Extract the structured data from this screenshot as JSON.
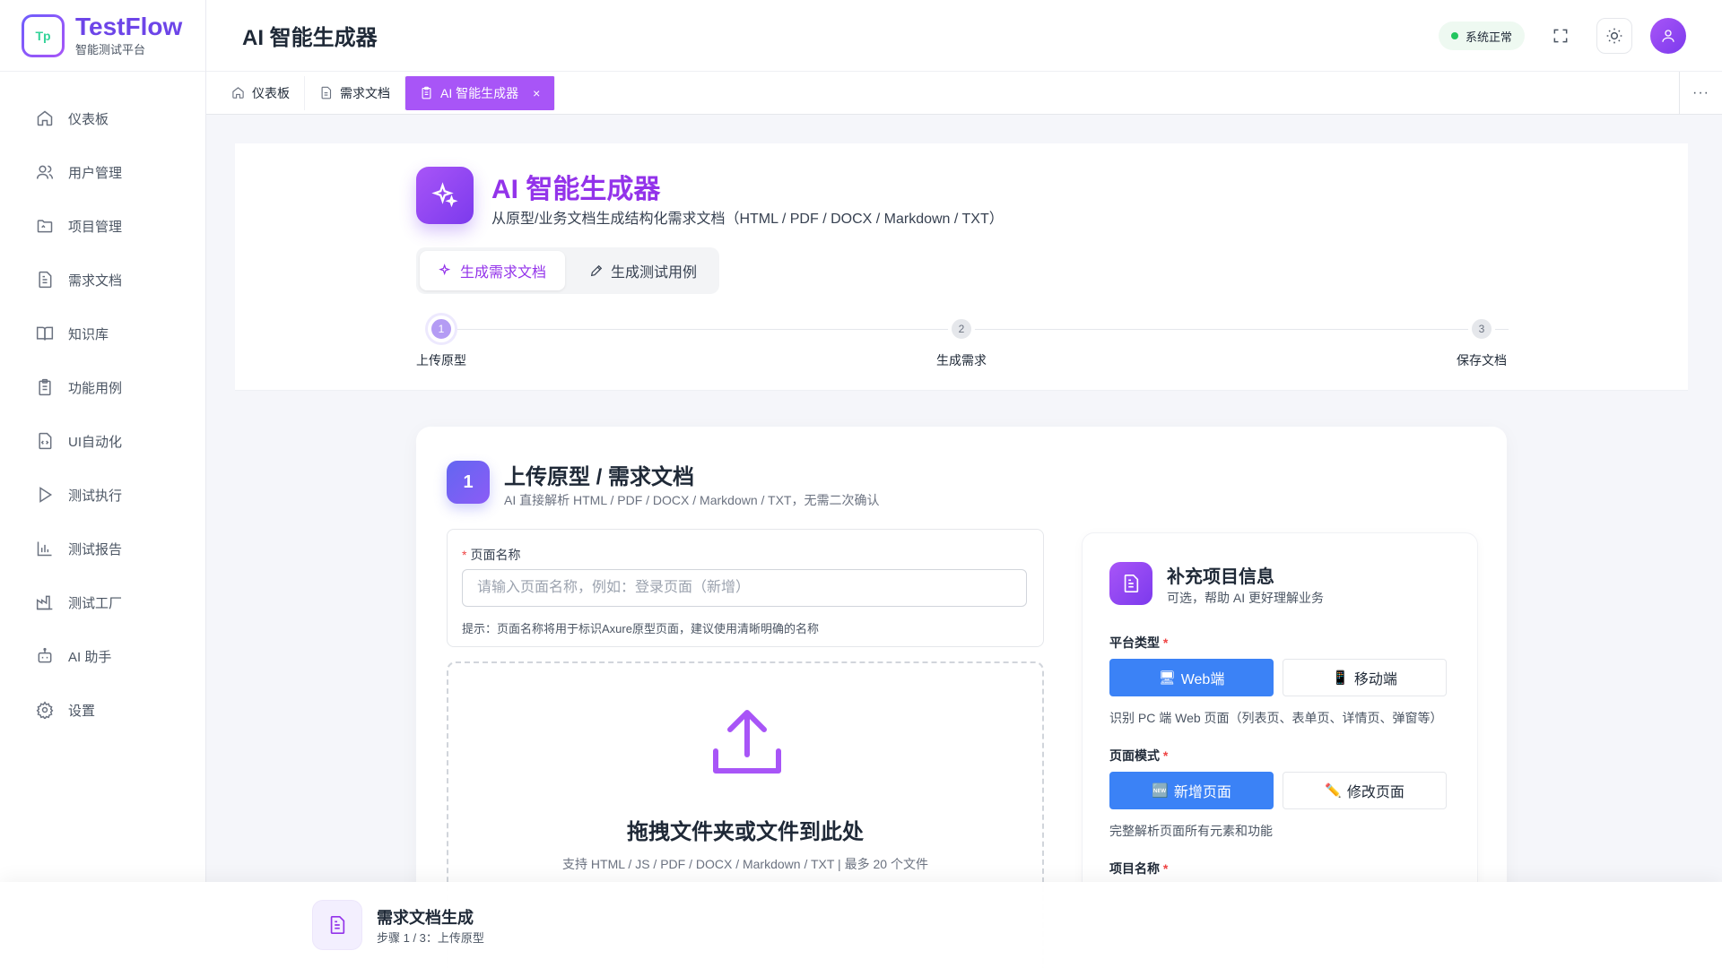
{
  "app": {
    "name": "TestFlow",
    "subtitle": "智能测试平台",
    "logo_mark": "Tp"
  },
  "sidebar": {
    "items": [
      {
        "label": "仪表板",
        "icon": "home-icon"
      },
      {
        "label": "用户管理",
        "icon": "users-icon"
      },
      {
        "label": "项目管理",
        "icon": "folder-icon"
      },
      {
        "label": "需求文档",
        "icon": "document-icon"
      },
      {
        "label": "知识库",
        "icon": "book-icon"
      },
      {
        "label": "功能用例",
        "icon": "clipboard-icon"
      },
      {
        "label": "UI自动化",
        "icon": "code-file-icon"
      },
      {
        "label": "测试执行",
        "icon": "play-icon"
      },
      {
        "label": "测试报告",
        "icon": "bar-chart-icon"
      },
      {
        "label": "测试工厂",
        "icon": "factory-icon"
      },
      {
        "label": "AI 助手",
        "icon": "robot-icon"
      },
      {
        "label": "设置",
        "icon": "gear-icon"
      }
    ]
  },
  "header": {
    "title": "AI 智能生成器",
    "status": "系统正常"
  },
  "tabs": [
    {
      "label": "仪表板",
      "active": false
    },
    {
      "label": "需求文档",
      "active": false
    },
    {
      "label": "AI 智能生成器",
      "active": true,
      "close": "×"
    }
  ],
  "generator": {
    "title": "AI 智能生成器",
    "subtitle": "从原型/业务文档生成结构化需求文档（HTML / PDF / DOCX / Markdown / TXT）",
    "modes": [
      "生成需求文档",
      "生成测试用例"
    ],
    "steps": [
      {
        "num": "1",
        "label": "上传原型"
      },
      {
        "num": "2",
        "label": "生成需求"
      },
      {
        "num": "3",
        "label": "保存文档"
      }
    ]
  },
  "upload": {
    "section_num": "1",
    "title": "上传原型 / 需求文档",
    "subtitle": "AI 直接解析 HTML / PDF / DOCX / Markdown / TXT，无需二次确认",
    "page_name_label": "页面名称",
    "page_name_placeholder": "请输入页面名称，例如：登录页面（新增）",
    "page_name_hint": "提示：页面名称将用于标识Axure原型页面，建议使用清晰明确的名称",
    "drop_title": "拖拽文件夹或文件到此处",
    "drop_sub": "支持 HTML / JS / PDF / DOCX / Markdown / TXT | 最多 20 个文件"
  },
  "project_info": {
    "title": "补充项目信息",
    "subtitle": "可选，帮助 AI 更好理解业务",
    "platform_label": "平台类型",
    "platform_options": [
      "Web端",
      "移动端"
    ],
    "platform_hint": "识别 PC 端 Web 页面（列表页、表单页、详情页、弹窗等）",
    "mode_label": "页面模式",
    "mode_options": [
      "新增页面",
      "修改页面"
    ],
    "mode_hint": "完整解析页面所有元素和功能",
    "project_name_label": "项目名称"
  },
  "bottom_bar": {
    "title": "需求文档生成",
    "step": "步骤 1 / 3：上传原型"
  },
  "colors": {
    "brand": "#9333ea",
    "accent_blue": "#3b82f6",
    "status_green": "#22c55e"
  }
}
